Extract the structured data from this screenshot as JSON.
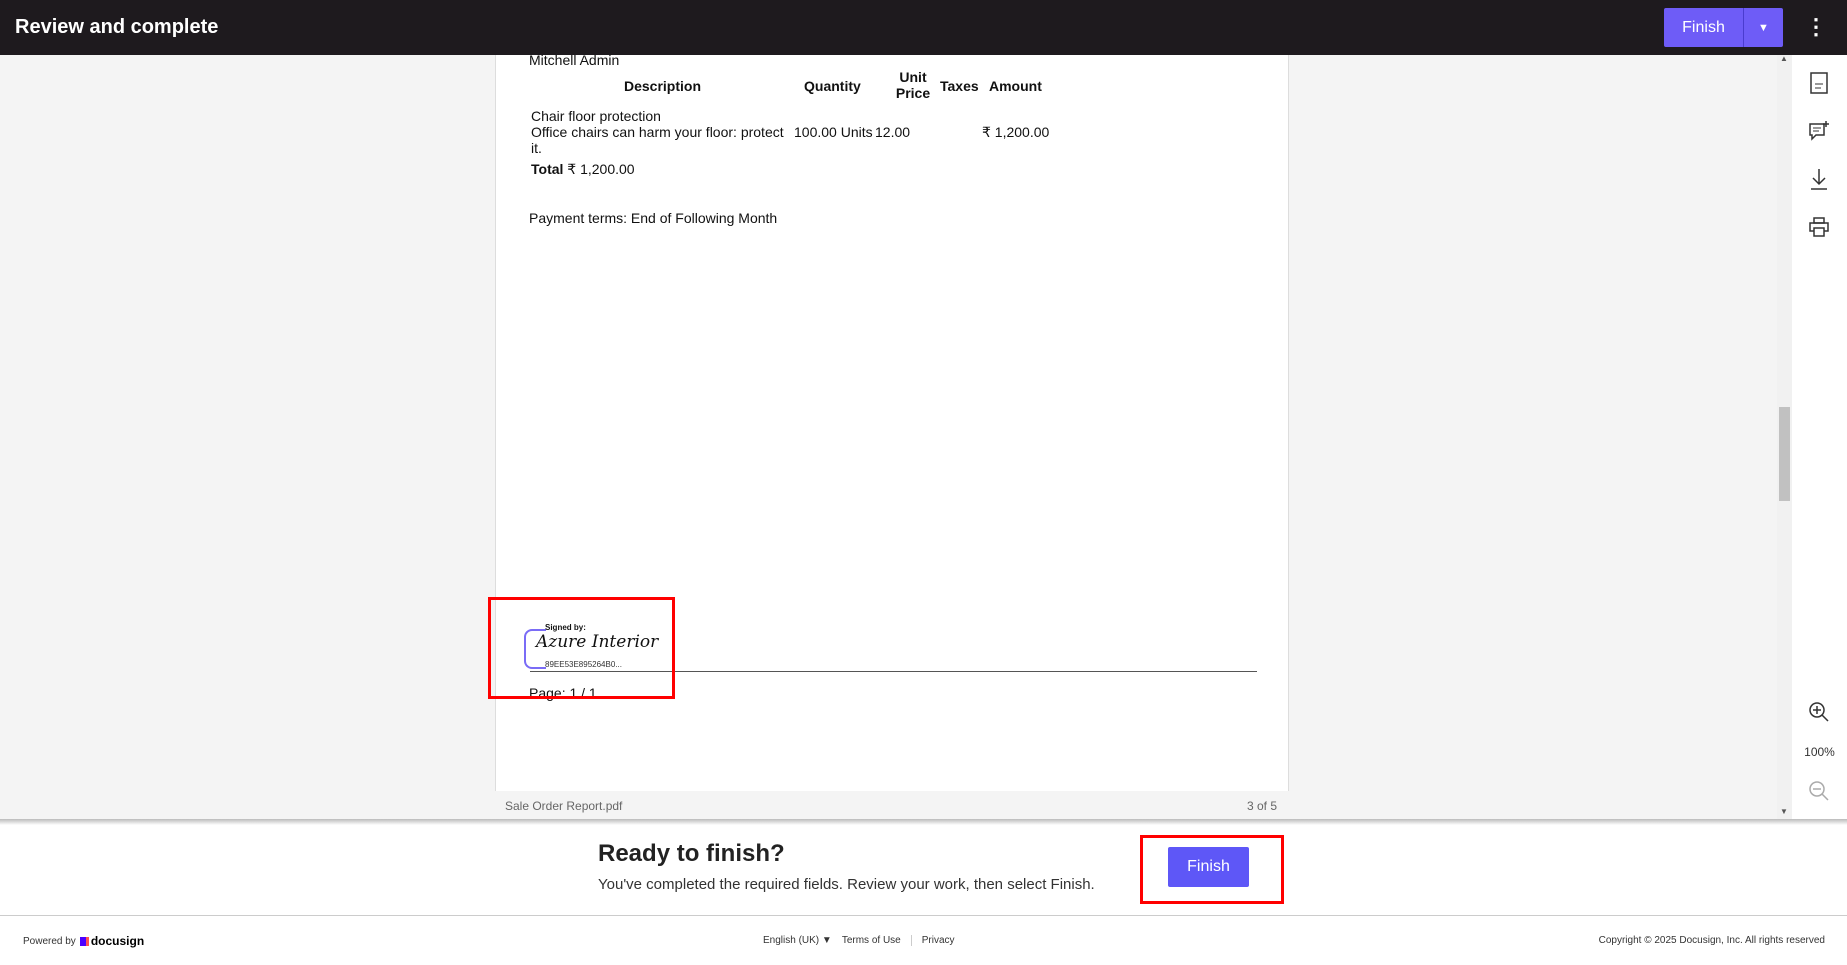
{
  "header": {
    "title": "Review and complete",
    "finish_label": "Finish",
    "dropdown_icon": "caret-down",
    "more_icon": "kebab"
  },
  "document": {
    "salesperson": "Mitchell Admin",
    "columns": [
      "Description",
      "Quantity",
      "Unit Price",
      "Taxes",
      "Amount"
    ],
    "line": {
      "name": "Chair floor protection",
      "desc1": "Office chairs can harm your floor: protect",
      "desc2": "it.",
      "quantity": "100.00 Units",
      "unit_price": "12.00",
      "amount": "₹ 1,200.00"
    },
    "total_label": "Total",
    "total_value": "₹ 1,200.00",
    "payment_terms": "Payment terms: End of Following Month",
    "signature": {
      "label": "Signed by:",
      "name": "Azure Interior",
      "hash": "89EE53E895264B0..."
    },
    "page_footer": "Page: 1 / 1"
  },
  "viewer": {
    "filename": "Sale Order Report.pdf",
    "page_count": "3 of 5",
    "zoom": "100%"
  },
  "finish_panel": {
    "title": "Ready to finish?",
    "message": "You've completed the required fields. Review your work, then select Finish.",
    "button": "Finish"
  },
  "footer": {
    "powered_by": "Powered by",
    "brand": "docusign",
    "language": "English (UK)",
    "terms": "Terms of Use",
    "privacy": "Privacy",
    "copyright": "Copyright © 2025 Docusign, Inc. All rights reserved"
  }
}
